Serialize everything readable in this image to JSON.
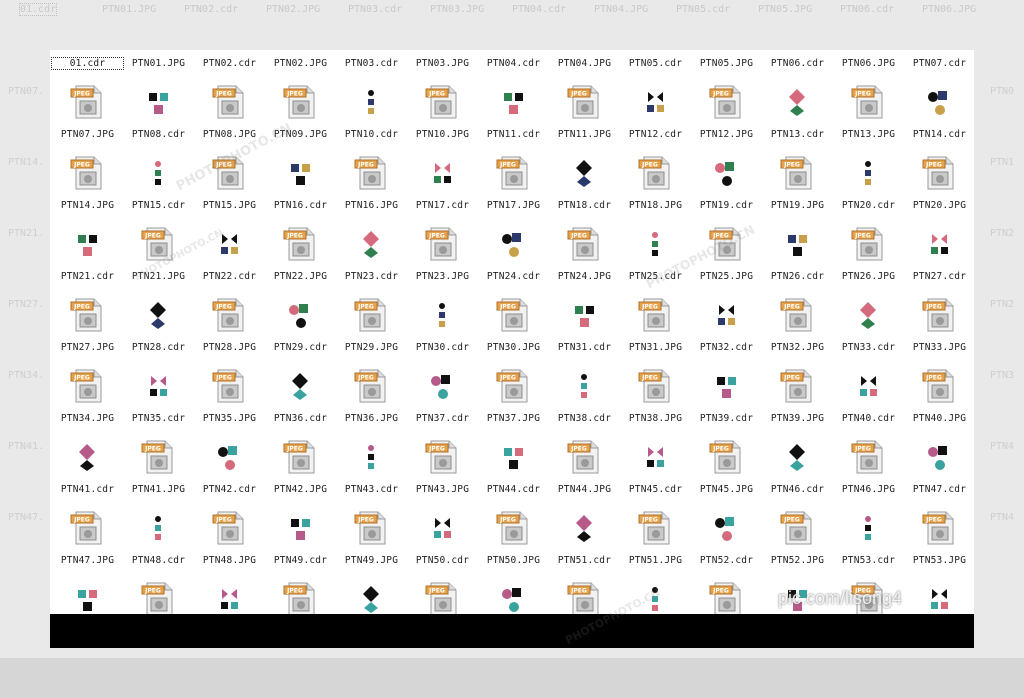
{
  "background_strip": [
    "01.cdr",
    "PTN01.JPG",
    "PTN02.cdr",
    "PTN02.JPG",
    "PTN03.cdr",
    "PTN03.JPG",
    "PTN04.cdr",
    "PTN04.JPG",
    "PTN05.cdr",
    "PTN05.JPG",
    "PTN06.cdr",
    "PTN06.JPG"
  ],
  "background_side": [
    "PTN07.",
    "PTN14.",
    "PTN21.",
    "PTN27.",
    "PTN34.",
    "PTN41.",
    "PTN47."
  ],
  "background_right": [
    "PTN0",
    "PTN1",
    "PTN2",
    "PTN2",
    "PTN3",
    "PTN4",
    "PTN4"
  ],
  "files": [
    {
      "name": "01.cdr",
      "type": "cdr-selected"
    },
    {
      "name": "PTN01.JPG",
      "type": "jpg"
    },
    {
      "name": "PTN02.cdr",
      "type": "cdr"
    },
    {
      "name": "PTN02.JPG",
      "type": "jpg"
    },
    {
      "name": "PTN03.cdr",
      "type": "cdr"
    },
    {
      "name": "PTN03.JPG",
      "type": "jpg"
    },
    {
      "name": "PTN04.cdr",
      "type": "cdr"
    },
    {
      "name": "PTN04.JPG",
      "type": "jpg"
    },
    {
      "name": "PTN05.cdr",
      "type": "cdr"
    },
    {
      "name": "PTN05.JPG",
      "type": "jpg"
    },
    {
      "name": "PTN06.cdr",
      "type": "cdr"
    },
    {
      "name": "PTN06.JPG",
      "type": "jpg"
    },
    {
      "name": "PTN07.cdr",
      "type": "cdr"
    },
    {
      "name": "PTN07.JPG",
      "type": "jpg"
    },
    {
      "name": "PTN08.cdr",
      "type": "cdr"
    },
    {
      "name": "PTN08.JPG",
      "type": "jpg"
    },
    {
      "name": "PTN09.JPG",
      "type": "jpg"
    },
    {
      "name": "PTN10.cdr",
      "type": "cdr"
    },
    {
      "name": "PTN10.JPG",
      "type": "jpg"
    },
    {
      "name": "PTN11.cdr",
      "type": "cdr"
    },
    {
      "name": "PTN11.JPG",
      "type": "jpg"
    },
    {
      "name": "PTN12.cdr",
      "type": "cdr"
    },
    {
      "name": "PTN12.JPG",
      "type": "jpg"
    },
    {
      "name": "PTN13.cdr",
      "type": "cdr"
    },
    {
      "name": "PTN13.JPG",
      "type": "jpg"
    },
    {
      "name": "PTN14.cdr",
      "type": "cdr"
    },
    {
      "name": "PTN14.JPG",
      "type": "jpg"
    },
    {
      "name": "PTN15.cdr",
      "type": "cdr"
    },
    {
      "name": "PTN15.JPG",
      "type": "jpg"
    },
    {
      "name": "PTN16.cdr",
      "type": "cdr"
    },
    {
      "name": "PTN16.JPG",
      "type": "jpg"
    },
    {
      "name": "PTN17.cdr",
      "type": "cdr"
    },
    {
      "name": "PTN17.JPG",
      "type": "jpg"
    },
    {
      "name": "PTN18.cdr",
      "type": "cdr"
    },
    {
      "name": "PTN18.JPG",
      "type": "jpg"
    },
    {
      "name": "PTN19.cdr",
      "type": "cdr"
    },
    {
      "name": "PTN19.JPG",
      "type": "jpg"
    },
    {
      "name": "PTN20.cdr",
      "type": "cdr"
    },
    {
      "name": "PTN20.JPG",
      "type": "jpg"
    },
    {
      "name": "PTN21.cdr",
      "type": "cdr"
    },
    {
      "name": "PTN21.JPG",
      "type": "jpg"
    },
    {
      "name": "PTN22.cdr",
      "type": "cdr"
    },
    {
      "name": "PTN22.JPG",
      "type": "jpg"
    },
    {
      "name": "PTN23.cdr",
      "type": "cdr"
    },
    {
      "name": "PTN23.JPG",
      "type": "jpg"
    },
    {
      "name": "PTN24.cdr",
      "type": "cdr"
    },
    {
      "name": "PTN24.JPG",
      "type": "jpg"
    },
    {
      "name": "PTN25.cdr",
      "type": "cdr"
    },
    {
      "name": "PTN25.JPG",
      "type": "jpg"
    },
    {
      "name": "PTN26.cdr",
      "type": "cdr"
    },
    {
      "name": "PTN26.JPG",
      "type": "jpg"
    },
    {
      "name": "PTN27.cdr",
      "type": "cdr"
    },
    {
      "name": "PTN27.JPG",
      "type": "jpg"
    },
    {
      "name": "PTN28.cdr",
      "type": "cdr"
    },
    {
      "name": "PTN28.JPG",
      "type": "jpg"
    },
    {
      "name": "PTN29.cdr",
      "type": "cdr"
    },
    {
      "name": "PTN29.JPG",
      "type": "jpg"
    },
    {
      "name": "PTN30.cdr",
      "type": "cdr"
    },
    {
      "name": "PTN30.JPG",
      "type": "jpg"
    },
    {
      "name": "PTN31.cdr",
      "type": "cdr"
    },
    {
      "name": "PTN31.JPG",
      "type": "jpg"
    },
    {
      "name": "PTN32.cdr",
      "type": "cdr"
    },
    {
      "name": "PTN32.JPG",
      "type": "jpg"
    },
    {
      "name": "PTN33.cdr",
      "type": "cdr"
    },
    {
      "name": "PTN33.JPG",
      "type": "jpg"
    },
    {
      "name": "PTN34.JPG",
      "type": "jpg"
    },
    {
      "name": "PTN35.cdr",
      "type": "cdr"
    },
    {
      "name": "PTN35.JPG",
      "type": "jpg"
    },
    {
      "name": "PTN36.cdr",
      "type": "cdr"
    },
    {
      "name": "PTN36.JPG",
      "type": "jpg"
    },
    {
      "name": "PTN37.cdr",
      "type": "cdr"
    },
    {
      "name": "PTN37.JPG",
      "type": "jpg"
    },
    {
      "name": "PTN38.cdr",
      "type": "cdr"
    },
    {
      "name": "PTN38.JPG",
      "type": "jpg"
    },
    {
      "name": "PTN39.cdr",
      "type": "cdr"
    },
    {
      "name": "PTN39.JPG",
      "type": "jpg"
    },
    {
      "name": "PTN40.cdr",
      "type": "cdr"
    },
    {
      "name": "PTN40.JPG",
      "type": "jpg"
    },
    {
      "name": "PTN41.cdr",
      "type": "cdr"
    },
    {
      "name": "PTN41.JPG",
      "type": "jpg"
    },
    {
      "name": "PTN42.cdr",
      "type": "cdr"
    },
    {
      "name": "PTN42.JPG",
      "type": "jpg"
    },
    {
      "name": "PTN43.cdr",
      "type": "cdr"
    },
    {
      "name": "PTN43.JPG",
      "type": "jpg"
    },
    {
      "name": "PTN44.cdr",
      "type": "cdr"
    },
    {
      "name": "PTN44.JPG",
      "type": "jpg"
    },
    {
      "name": "PTN45.cdr",
      "type": "cdr"
    },
    {
      "name": "PTN45.JPG",
      "type": "jpg"
    },
    {
      "name": "PTN46.cdr",
      "type": "cdr"
    },
    {
      "name": "PTN46.JPG",
      "type": "jpg"
    },
    {
      "name": "PTN47.cdr",
      "type": "cdr"
    },
    {
      "name": "PTN47.JPG",
      "type": "jpg"
    },
    {
      "name": "PTN48.cdr",
      "type": "cdr"
    },
    {
      "name": "PTN48.JPG",
      "type": "jpg"
    },
    {
      "name": "PTN49.cdr",
      "type": "cdr"
    },
    {
      "name": "PTN49.JPG",
      "type": "jpg"
    },
    {
      "name": "PTN50.cdr",
      "type": "cdr"
    },
    {
      "name": "PTN50.JPG",
      "type": "jpg"
    },
    {
      "name": "PTN51.cdr",
      "type": "cdr"
    },
    {
      "name": "PTN51.JPG",
      "type": "jpg"
    },
    {
      "name": "PTN52.cdr",
      "type": "cdr"
    },
    {
      "name": "PTN52.JPG",
      "type": "jpg"
    },
    {
      "name": "PTN53.cdr",
      "type": "cdr"
    },
    {
      "name": "PTN53.JPG",
      "type": "jpg"
    },
    {
      "name": "",
      "type": "cdr"
    },
    {
      "name": "",
      "type": "jpg"
    },
    {
      "name": "",
      "type": "cdr"
    },
    {
      "name": "",
      "type": "jpg"
    },
    {
      "name": "",
      "type": "cdr"
    },
    {
      "name": "",
      "type": "jpg"
    },
    {
      "name": "",
      "type": "cdr"
    },
    {
      "name": "",
      "type": "jpg"
    },
    {
      "name": "",
      "type": "cdr"
    },
    {
      "name": "",
      "type": "jpg"
    },
    {
      "name": "",
      "type": "cdr"
    },
    {
      "name": "",
      "type": "jpg"
    },
    {
      "name": "",
      "type": "cdr"
    }
  ],
  "jpeg_badge": "JPEG",
  "watermark_text": "PHOTOPHOTO.CN",
  "credit": "pic.com/lisong4",
  "colors": {
    "badge": "#e6a24a",
    "page": "#f2f2f2",
    "accent_teal": "#3aa3a0",
    "accent_pink": "#d56a7c",
    "accent_navy": "#2b3a6b"
  }
}
